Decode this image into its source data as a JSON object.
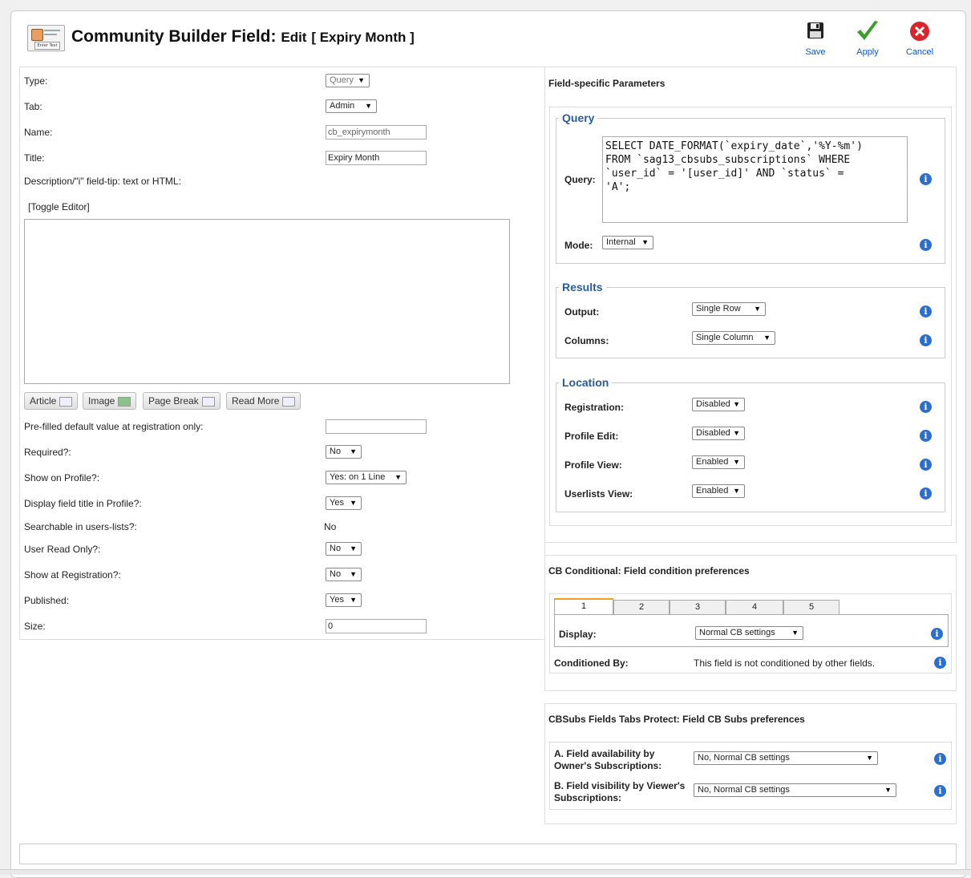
{
  "header": {
    "logo_text": "Enter Text",
    "title_main": "Community Builder Field:",
    "title_edit": "Edit",
    "title_bracket": "[ Expiry Month ]"
  },
  "toolbar": {
    "save_label": "Save",
    "apply_label": "Apply",
    "cancel_label": "Cancel"
  },
  "general": {
    "type_label": "Type:",
    "type_value": "Query",
    "tab_label": "Tab:",
    "tab_value": "Admin",
    "name_label": "Name:",
    "name_value": "cb_expirymonth",
    "title_label": "Title:",
    "title_value": "Expiry Month",
    "description_label": "Description/\"i\" field-tip: text or HTML:",
    "toggle_editor": "[Toggle Editor]",
    "editor_buttons": [
      "Article",
      "Image",
      "Page Break",
      "Read More"
    ],
    "prefilled_label": "Pre-filled default value at registration only:",
    "prefilled_value": "",
    "required_label": "Required?:",
    "required_value": "No",
    "show_profile_label": "Show on Profile?:",
    "show_profile_value": "Yes: on 1 Line",
    "display_title_label": "Display field title in Profile?:",
    "display_title_value": "Yes",
    "searchable_label": "Searchable in users-lists?:",
    "searchable_value": "No",
    "read_only_label": "User Read Only?:",
    "read_only_value": "No",
    "show_reg_label": "Show at Registration?:",
    "show_reg_value": "No",
    "published_label": "Published:",
    "published_value": "Yes",
    "size_label": "Size:",
    "size_value": "0"
  },
  "params": {
    "title": "Field-specific Parameters",
    "query_legend": "Query",
    "query_label": "Query:",
    "query_value": "SELECT DATE_FORMAT(`expiry_date`,'%Y-%m')\nFROM `sag13_cbsubs_subscriptions` WHERE\n`user_id` = '[user_id]' AND `status` =\n'A';",
    "mode_label": "Mode:",
    "mode_value": "Internal",
    "results_legend": "Results",
    "output_label": "Output:",
    "output_value": "Single Row",
    "columns_label": "Columns:",
    "columns_value": "Single Column",
    "location_legend": "Location",
    "registration_label": "Registration:",
    "registration_value": "Disabled",
    "profile_edit_label": "Profile Edit:",
    "profile_edit_value": "Disabled",
    "profile_view_label": "Profile View:",
    "profile_view_value": "Enabled",
    "userlists_label": "Userlists View:",
    "userlists_value": "Enabled"
  },
  "conditional": {
    "title": "CB Conditional: Field condition preferences",
    "tabs": [
      "1",
      "2",
      "3",
      "4",
      "5"
    ],
    "display_label": "Display:",
    "display_value": "Normal CB settings",
    "conditioned_label": "Conditioned By:",
    "conditioned_value": "This field is not conditioned by other fields."
  },
  "cbsubs": {
    "title": "CBSubs Fields Tabs Protect: Field CB Subs preferences",
    "a_label_1": "A. Field availability by",
    "a_label_2": "Owner's Subscriptions:",
    "a_value": "No, Normal CB settings",
    "b_label_1": "B. Field visibility by Viewer's",
    "b_label_2": "Subscriptions:",
    "b_value": "No, Normal CB settings"
  },
  "icons": {
    "save": "floppy-disk-icon",
    "apply": "checkmark-icon",
    "cancel": "cancel-x-icon",
    "info": "info-icon"
  }
}
